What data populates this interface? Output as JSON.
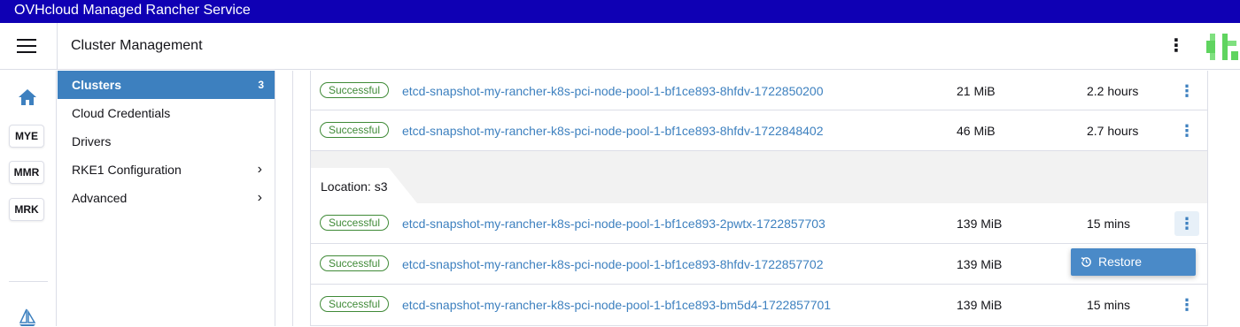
{
  "topbar": {
    "title": "OVHcloud Managed Rancher Service"
  },
  "header": {
    "title": "Cluster Management"
  },
  "rail": {
    "clusters": [
      {
        "label": "MYE"
      },
      {
        "label": "MMR"
      },
      {
        "label": "MRK"
      }
    ]
  },
  "sidebar": {
    "items": [
      {
        "label": "Clusters",
        "count": "3",
        "active": true
      },
      {
        "label": "Cloud Credentials"
      },
      {
        "label": "Drivers"
      },
      {
        "label": "RKE1 Configuration",
        "expandable": true
      },
      {
        "label": "Advanced",
        "expandable": true
      }
    ]
  },
  "snapshots": {
    "rows_top": [
      {
        "status": "Successful",
        "name": "etcd-snapshot-my-rancher-k8s-pci-node-pool-1-bf1ce893-8hfdv-1722850200",
        "size": "21 MiB",
        "age": "2.2 hours"
      },
      {
        "status": "Successful",
        "name": "etcd-snapshot-my-rancher-k8s-pci-node-pool-1-bf1ce893-8hfdv-1722848402",
        "size": "46 MiB",
        "age": "2.7 hours"
      }
    ],
    "group": {
      "label": "Location: s3"
    },
    "rows_group": [
      {
        "status": "Successful",
        "name": "etcd-snapshot-my-rancher-k8s-pci-node-pool-1-bf1ce893-2pwtx-1722857703",
        "size": "139 MiB",
        "age": "15 mins"
      },
      {
        "status": "Successful",
        "name": "etcd-snapshot-my-rancher-k8s-pci-node-pool-1-bf1ce893-8hfdv-1722857702",
        "size": "139 MiB",
        "age": ""
      },
      {
        "status": "Successful",
        "name": "etcd-snapshot-my-rancher-k8s-pci-node-pool-1-bf1ce893-bm5d4-1722857701",
        "size": "139 MiB",
        "age": "15 mins"
      }
    ]
  },
  "context_menu": {
    "item_label": "Restore",
    "icon": "restore-icon"
  },
  "colors": {
    "topbar": "#0f00b4",
    "accent": "#3d80bf",
    "success": "#3f8a37"
  }
}
